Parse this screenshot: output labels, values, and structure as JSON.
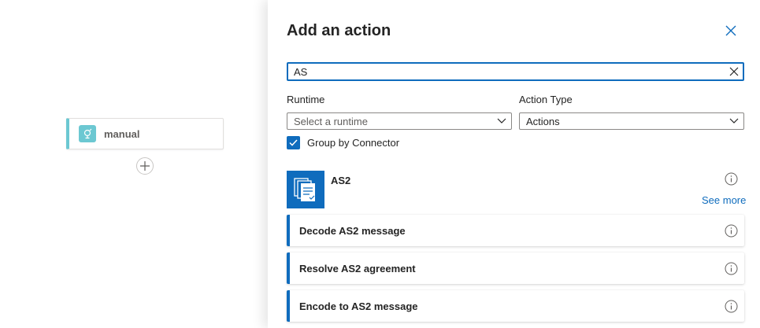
{
  "canvas": {
    "trigger": {
      "label": "manual",
      "icon": "trigger-icon",
      "color": "#6cc8d2"
    }
  },
  "panel": {
    "title": "Add an action",
    "search": {
      "value": "AS",
      "placeholder": ""
    },
    "filters": {
      "runtime": {
        "label": "Runtime",
        "placeholder": "Select a runtime"
      },
      "action_type": {
        "label": "Action Type",
        "value": "Actions"
      }
    },
    "group_by_connector": {
      "label": "Group by Connector",
      "checked": true
    },
    "connector": {
      "name": "AS2",
      "see_more": "See more",
      "color": "#0f6cbd",
      "actions": [
        {
          "label": "Decode AS2 message"
        },
        {
          "label": "Resolve AS2 agreement"
        },
        {
          "label": "Encode to AS2 message"
        }
      ]
    }
  },
  "colors": {
    "accent": "#0f6cbd",
    "trigger": "#6cc8d2"
  }
}
